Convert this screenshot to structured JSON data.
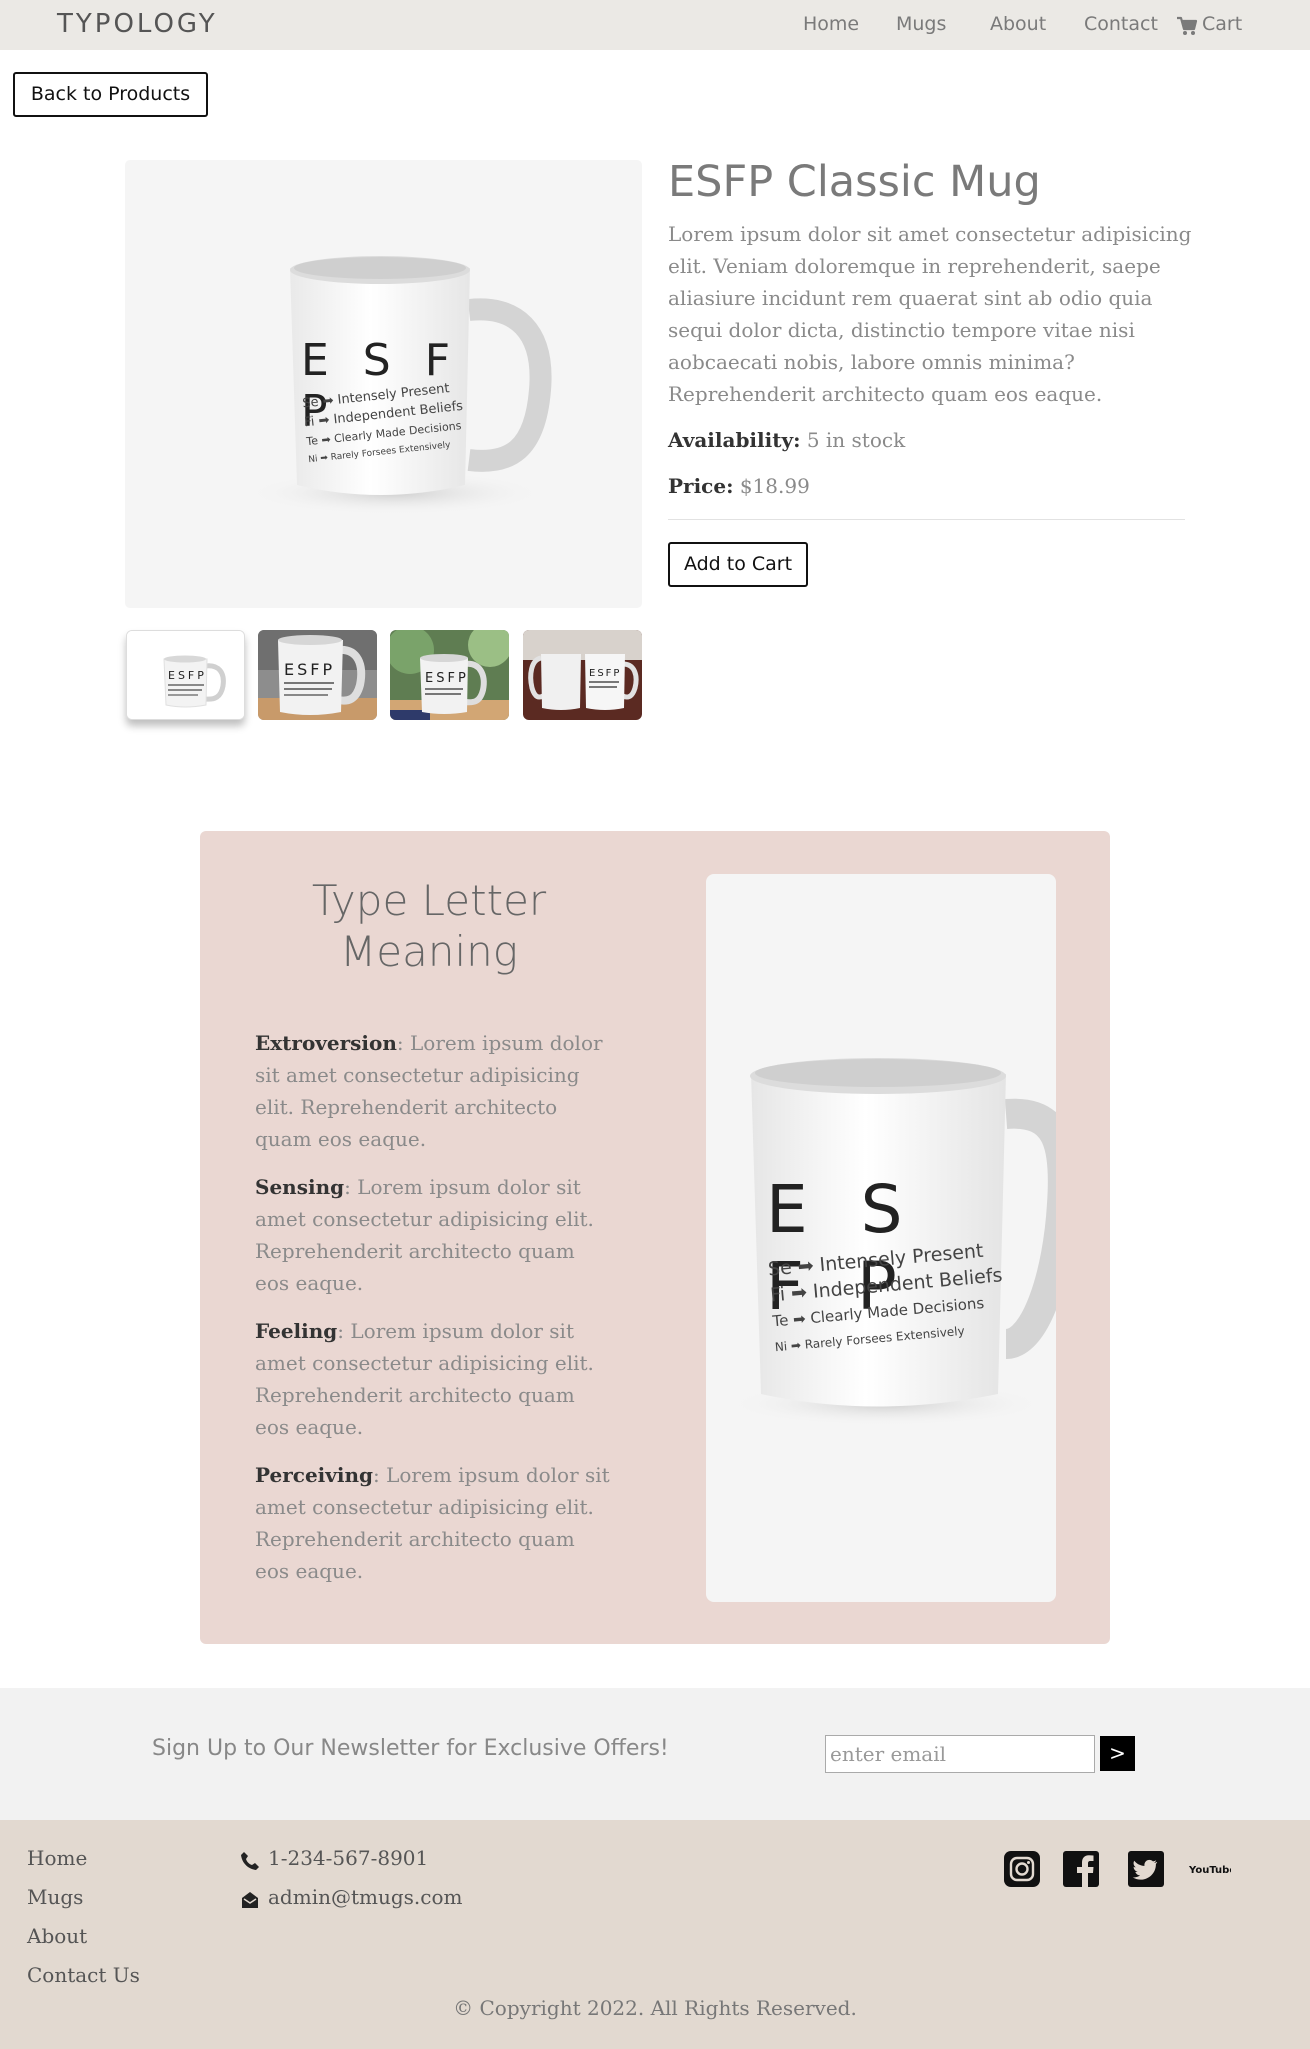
{
  "nav": {
    "brand": "TYPOLOGY",
    "links": [
      "Home",
      "Mugs",
      "About",
      "Contact"
    ],
    "cart_label": "Cart"
  },
  "back_button": "Back to Products",
  "product": {
    "title": "ESFP Classic Mug",
    "description": "Lorem ipsum dolor sit amet consectetur adipisicing elit. Veniam doloremque in reprehenderit, saepe aliasiure incidunt rem quaerat sint ab odio quia sequi dolor dicta, distinctio tempore vitae nisi aobcaecati nobis, labore omnis minima? Reprehenderit architecto quam eos eaque.",
    "availability_label": "Availability:",
    "availability_value": "5 in stock",
    "price_label": "Price:",
    "price_value": "$18.99",
    "add_to_cart": "Add to Cart"
  },
  "mug_print": {
    "letters": "E S F P",
    "lines": [
      "Se ➡ Intensely Present",
      "Fi ➡ Independent Beliefs",
      "Te ➡ Clearly Made Decisions",
      "Ni ➡ Rarely Forsees Extensively"
    ]
  },
  "meaning": {
    "title": "Type Letter Meaning",
    "items": [
      {
        "term": "Extroversion",
        "text": ": Lorem ipsum dolor sit amet consectetur adipisicing elit. Reprehenderit architecto quam eos eaque."
      },
      {
        "term": "Sensing",
        "text": ": Lorem ipsum dolor sit amet consectetur adipisicing elit. Reprehenderit architecto quam eos eaque."
      },
      {
        "term": "Feeling",
        "text": ": Lorem ipsum dolor sit amet consectetur adipisicing elit. Reprehenderit architecto quam eos eaque."
      },
      {
        "term": "Perceiving",
        "text": ": Lorem ipsum dolor sit amet consectetur adipisicing elit. Reprehenderit architecto quam eos eaque."
      }
    ]
  },
  "newsletter": {
    "text": "Sign Up to Our Newsletter for Exclusive Offers!",
    "placeholder": "enter email",
    "submit_label": ">"
  },
  "footer": {
    "links": [
      "Home",
      "Mugs",
      "About",
      "Contact Us"
    ],
    "phone": "1-234-567-8901",
    "email": "admin@tmugs.com",
    "social": [
      "instagram-icon",
      "facebook-icon",
      "twitter-icon",
      "youtube-icon"
    ],
    "youtube_text": "YouTube",
    "copyright": "© Copyright 2022. All Rights Reserved."
  },
  "colors": {
    "navbar_bg": "#ebe9e5",
    "card_bg": "#ead7d2",
    "newsletter_bg": "#f2f2f2",
    "footer_bg": "#e2d9d0"
  }
}
